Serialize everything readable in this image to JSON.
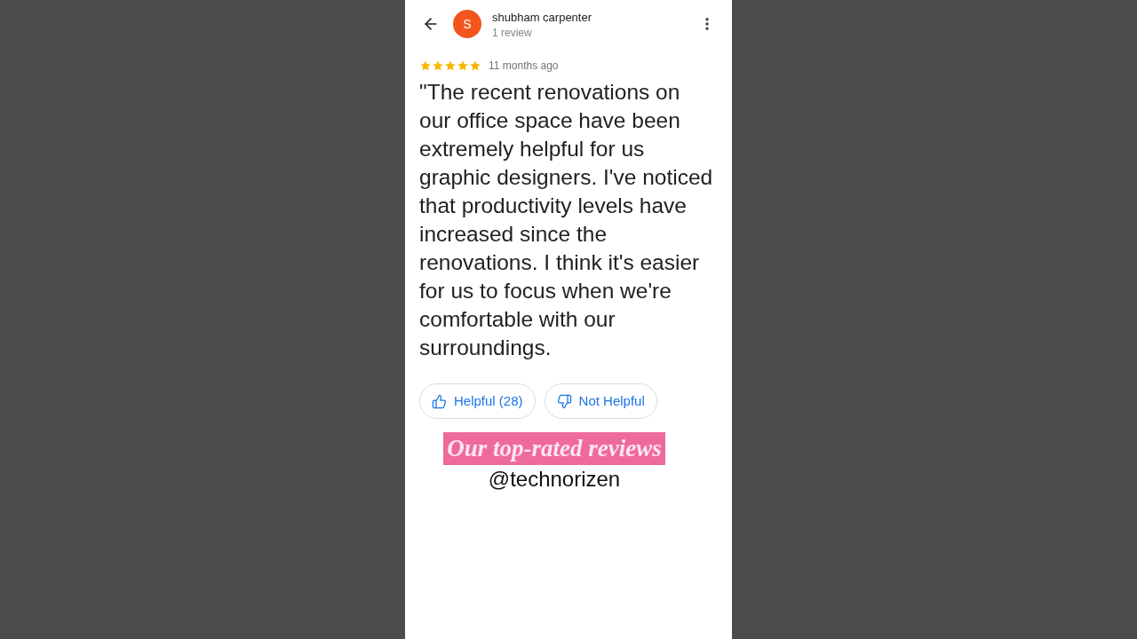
{
  "header": {
    "avatar_letter": "S",
    "reviewer_name": "shubham carpenter",
    "review_count": "1 review"
  },
  "review": {
    "stars": 5,
    "time": "11 months ago",
    "text": "\"The recent renovations on our office space have been extremely helpful for us graphic designers. I've noticed that productivity levels have increased since the renovations. I think it's easier for us to focus when we're comfortable with our surroundings."
  },
  "actions": [
    {
      "kind": "helpful",
      "label": "Helpful (28)"
    },
    {
      "kind": "not_helpful",
      "label": "Not Helpful"
    }
  ],
  "overlay": {
    "title": "Our top-rated reviews",
    "handle": "@technorizen"
  }
}
